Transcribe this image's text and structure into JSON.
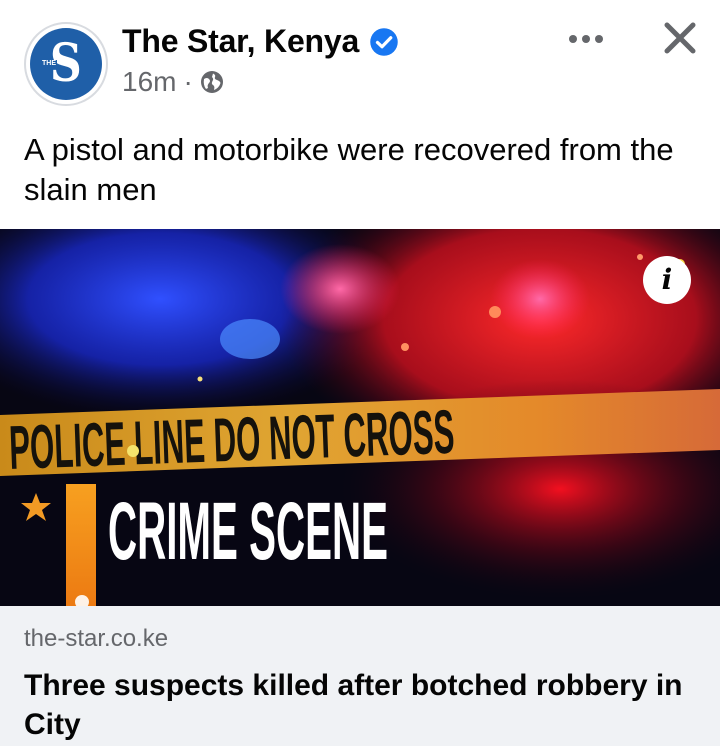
{
  "post": {
    "page_name": "The Star, Kenya",
    "avatar_letter": "S",
    "avatar_tag": "THE",
    "verified": true,
    "time": "16m",
    "separator": "·",
    "audience_icon": "globe-icon",
    "caption": "A pistol and motorbike were recovered from the slain men"
  },
  "header_actions": {
    "more_icon": "more-horizontal-icon",
    "close_icon": "close-icon"
  },
  "link_preview": {
    "image": {
      "tape_text": "POLICE LINE DO NOT CROSS",
      "headline_text": "CRIME SCENE",
      "info_glyph": "i"
    },
    "domain": "the-star.co.ke",
    "title": "Three suspects killed after botched robbery in City"
  },
  "colors": {
    "verified_blue": "#1877f2",
    "secondary_text": "#65676b",
    "tape_yellow": "#e8a21c",
    "link_footer_bg": "#f0f2f5"
  }
}
